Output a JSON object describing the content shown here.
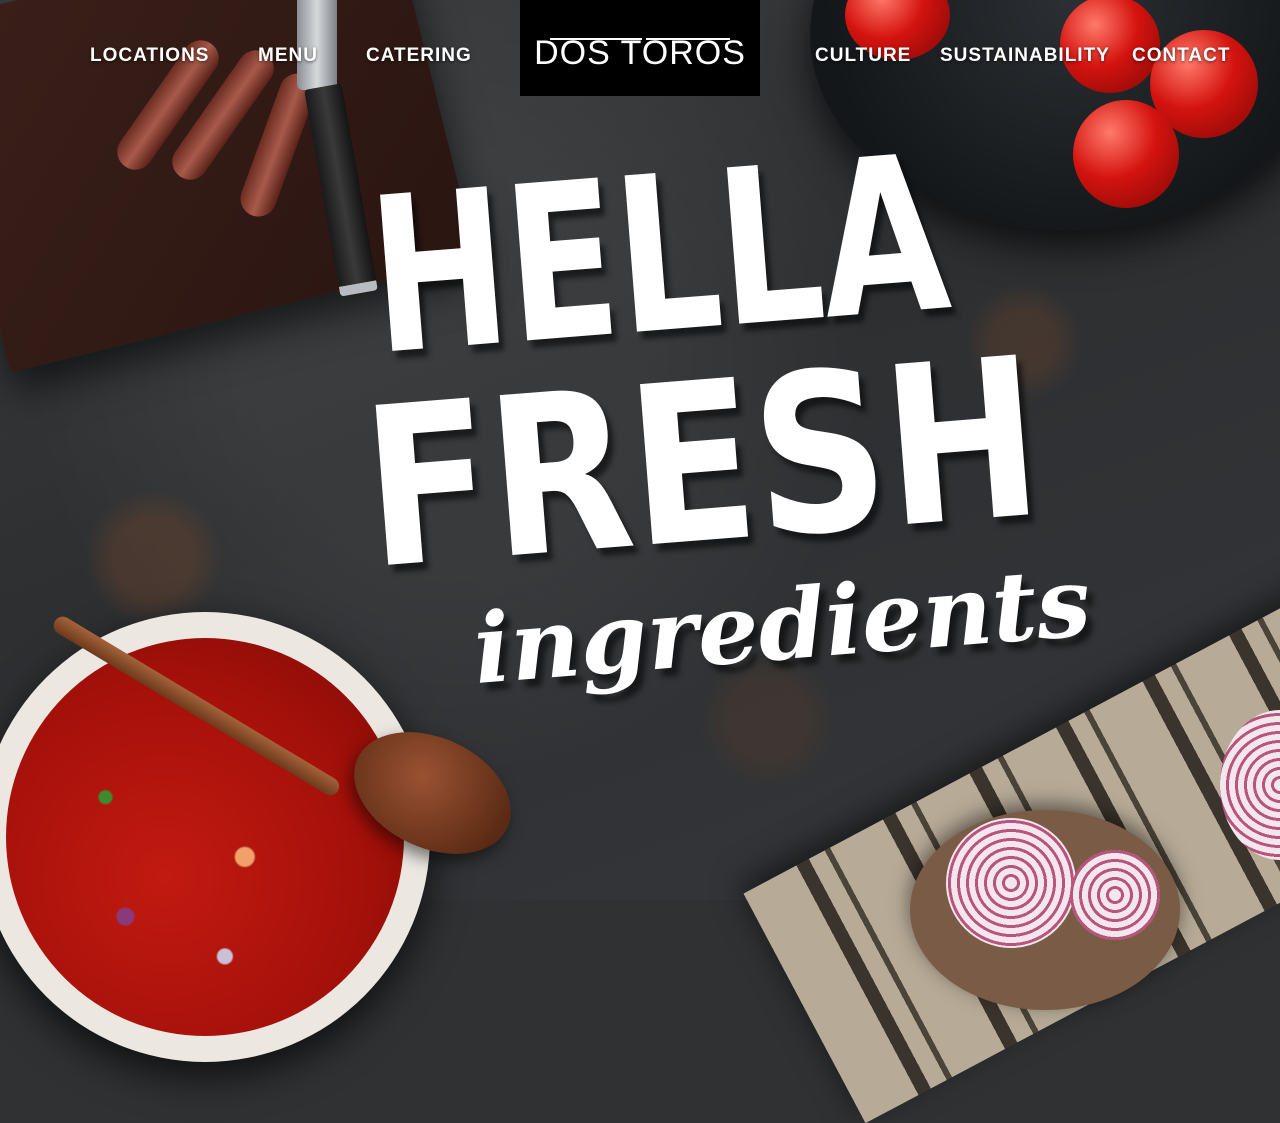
{
  "brand": {
    "logo_text": "DOS TOROS"
  },
  "nav": {
    "left": [
      "LOCATIONS",
      "MENU",
      "CATERING"
    ],
    "right": [
      "CULTURE",
      "SUSTAINABILITY",
      "CONTACT"
    ]
  },
  "hero": {
    "line1": "HELLA",
    "line2": "FRESH",
    "line3": "ingredients"
  },
  "colors": {
    "text": "#ffffff",
    "logo_bg": "#000000",
    "background": "#2f3133"
  }
}
